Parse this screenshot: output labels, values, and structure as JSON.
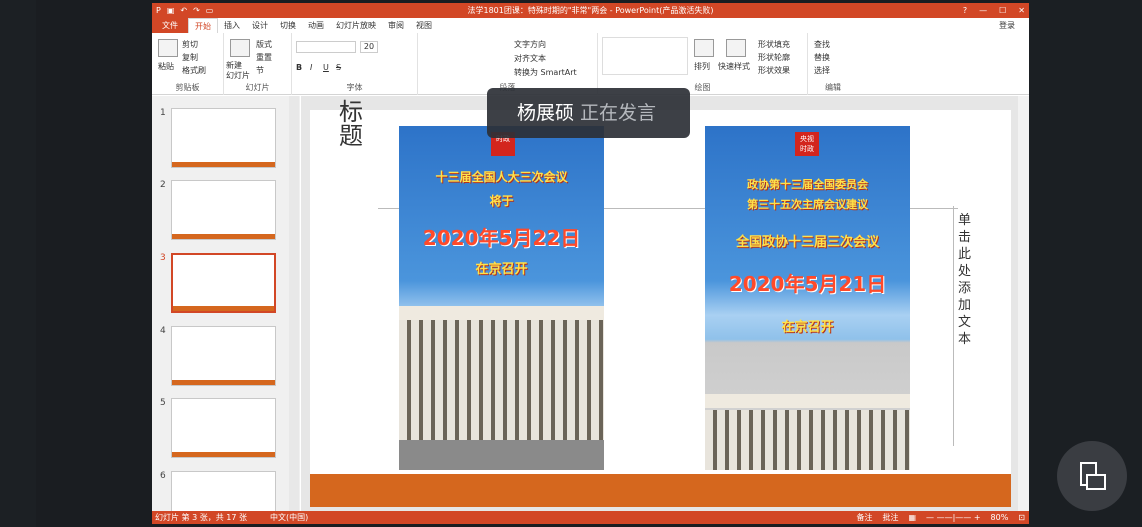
{
  "window": {
    "title": "法学1801团课：特殊时期的\"非常\"两会 - PowerPoint(产品激活失败)",
    "help": "?",
    "min": "—",
    "max": "☐",
    "close": "✕"
  },
  "tabs": [
    {
      "label": "文件"
    },
    {
      "label": "开始"
    },
    {
      "label": "插入"
    },
    {
      "label": "设计"
    },
    {
      "label": "切换"
    },
    {
      "label": "动画"
    },
    {
      "label": "幻灯片放映"
    },
    {
      "label": "审阅"
    },
    {
      "label": "视图"
    }
  ],
  "login": "登录",
  "ribbon": {
    "clipboard": {
      "paste": "粘贴",
      "cut": "剪切",
      "copy": "复制",
      "format_painter": "格式刷",
      "label": "剪贴板"
    },
    "slides": {
      "new_slide": "新建\n幻灯片",
      "layout": "版式",
      "reset": "重置",
      "section": "节",
      "label": "幻灯片"
    },
    "font": {
      "size": "20",
      "bold": "B",
      "italic": "I",
      "underline": "U",
      "strike": "S",
      "label": "字体"
    },
    "paragraph": {
      "text_direction": "文字方向",
      "align_text": "对齐文本",
      "smartart": "转换为 SmartArt",
      "label": "段落"
    },
    "drawing": {
      "arrange": "排列",
      "quick_styles": "快速样式",
      "shape_fill": "形状填充",
      "shape_outline": "形状轮廓",
      "shape_effects": "形状效果",
      "label": "绘图"
    },
    "editing": {
      "find": "查找",
      "replace": "替换",
      "select": "选择",
      "label": "编辑"
    }
  },
  "thumbnails": [
    {
      "num": "1"
    },
    {
      "num": "2"
    },
    {
      "num": "3"
    },
    {
      "num": "4"
    },
    {
      "num": "5"
    },
    {
      "num": "6"
    }
  ],
  "slide": {
    "title": "标题",
    "left_poster": {
      "logo": "时政",
      "line1": "十三届全国人大三次会议",
      "line2": "将于",
      "date": "2020年5月22日",
      "line3": "在京召开"
    },
    "right_poster": {
      "logo": "央视\n时政",
      "line1": "政协第十三届全国委员会",
      "line2": "第三十五次主席会议建议",
      "line3": "全国政协十三届三次会议",
      "date": "2020年5月21日",
      "line4": "在京召开"
    },
    "placeholder": "单击此处添加文本"
  },
  "status": {
    "slide_info": "幻灯片 第 3 张，共 17 张",
    "lang": "中文(中国)",
    "notes": "备注",
    "comments": "批注",
    "zoom": "80%"
  },
  "toast": {
    "name": "杨展硕",
    "state": "正在发言"
  },
  "colors": {
    "accent": "#d24726",
    "orange_bar": "#d5671e"
  }
}
